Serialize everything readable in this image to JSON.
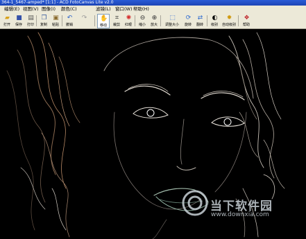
{
  "window": {
    "title": "364-1_5467-amped* [1:1] - ACD FotoCanvas Lite v2.0"
  },
  "menu": [
    "编辑(E)",
    "视图(V)",
    "图像(I)",
    "颜色(C)",
    "滤镜(L)",
    "窗口(W)",
    "帮助(H)"
  ],
  "toolbar": {
    "open": "打开",
    "save": "保存",
    "print": "打印",
    "copy": "复制",
    "paste": "粘贴",
    "undo": "撤销",
    "move": "移动",
    "crop": "裁剪",
    "redeye": "红眼",
    "zoom_out": "缩小",
    "zoom_in": "放大",
    "resize": "调整大小",
    "rotate": "旋转",
    "flip": "翻转",
    "levels": "级别",
    "auto_levels": "自动级别",
    "help": "帮助"
  },
  "watermark": {
    "text": "当下软件园",
    "url": "www.downxia.com"
  }
}
